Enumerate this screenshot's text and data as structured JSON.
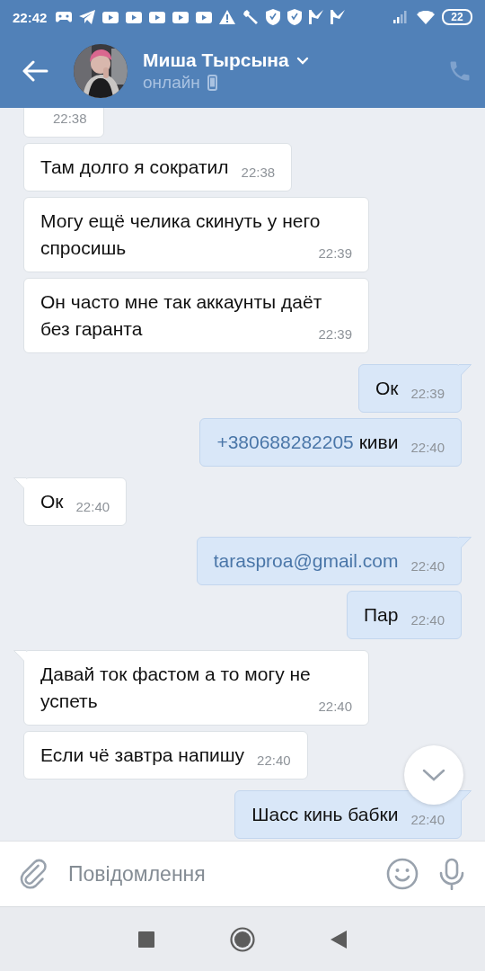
{
  "status_bar": {
    "time": "22:42",
    "battery": "22"
  },
  "header": {
    "name": "Миша Тырсына",
    "status": "онлайн"
  },
  "messages": [
    {
      "outgoing": false,
      "kind": "cut",
      "time": "22:38"
    },
    {
      "outgoing": false,
      "kind": "text",
      "text": "Там долго я сократил",
      "time": "22:38"
    },
    {
      "outgoing": false,
      "kind": "text",
      "text": "Могу ещё челика скинуть у него спросишь",
      "time": "22:39"
    },
    {
      "outgoing": false,
      "kind": "text",
      "text": "Он часто мне так аккаунты даёт без гаранта",
      "time": "22:39"
    },
    {
      "outgoing": true,
      "kind": "text",
      "text": "Ок",
      "time": "22:39"
    },
    {
      "outgoing": true,
      "kind": "link",
      "link": "+380688282205",
      "text": "киви",
      "time": "22:40"
    },
    {
      "outgoing": false,
      "kind": "text",
      "text": "Ок",
      "time": "22:40"
    },
    {
      "outgoing": true,
      "kind": "link",
      "link": "tarasproa@gmail.com",
      "time": "22:40"
    },
    {
      "outgoing": true,
      "kind": "text",
      "text": "Пар",
      "time": "22:40"
    },
    {
      "outgoing": false,
      "kind": "text",
      "text": "Давай ток фастом а то могу не успеть",
      "time": "22:40"
    },
    {
      "outgoing": false,
      "kind": "text",
      "text": "Если чё завтра напишу",
      "time": "22:40"
    },
    {
      "outgoing": true,
      "kind": "text",
      "text": "Шасс кинь бабки",
      "time": "22:40"
    }
  ],
  "composer": {
    "placeholder": "Повідомлення"
  }
}
